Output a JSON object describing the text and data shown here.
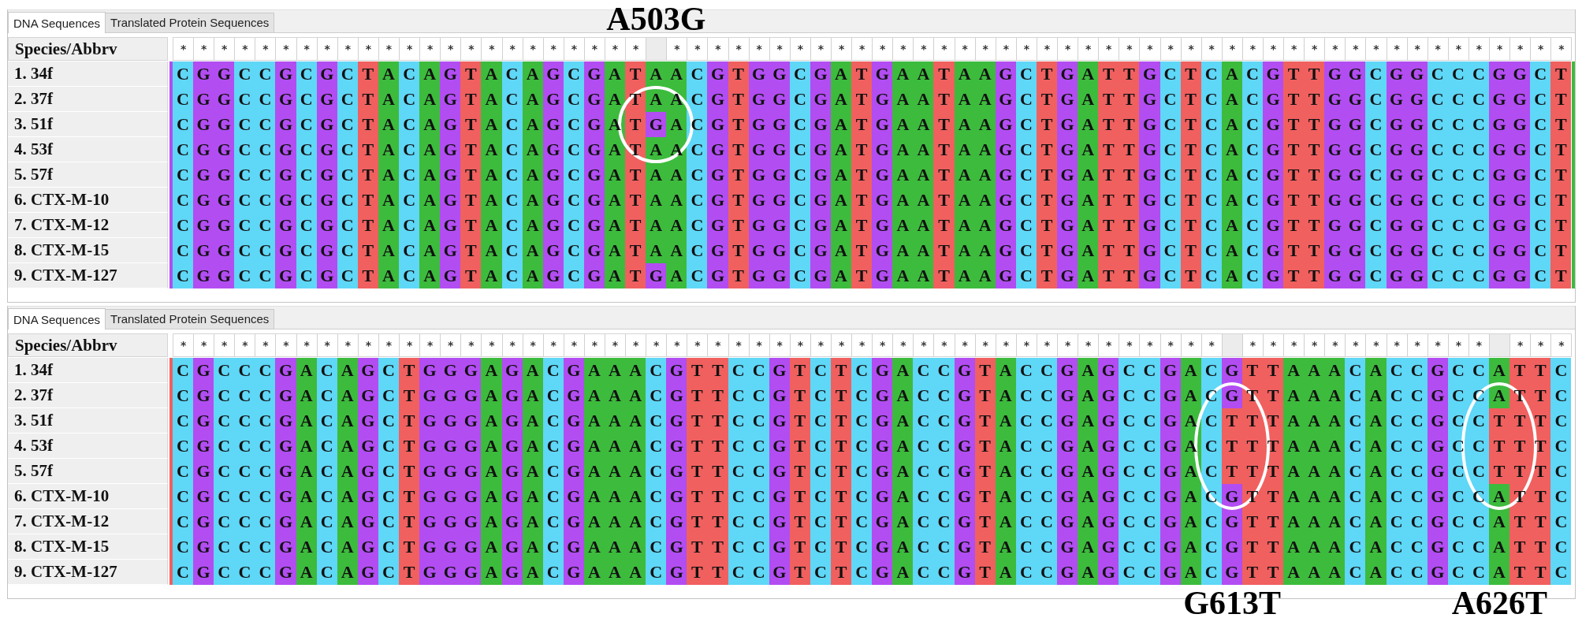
{
  "panels": [
    {
      "tabs": [
        {
          "label": "DNA Sequences",
          "selected": true
        },
        {
          "label": "Translated Protein Sequences",
          "selected": false
        }
      ],
      "mutations": [
        {
          "label": "A503G",
          "kind": "above"
        }
      ],
      "header": "Species/Abbrv",
      "consensus": [
        {
          "conserved": true,
          "mark": "*"
        },
        {
          "conserved": true,
          "mark": "*"
        },
        {
          "conserved": true,
          "mark": "*"
        },
        {
          "conserved": true,
          "mark": "*"
        },
        {
          "conserved": true,
          "mark": "*"
        },
        {
          "conserved": true,
          "mark": "*"
        },
        {
          "conserved": true,
          "mark": "*"
        },
        {
          "conserved": true,
          "mark": "*"
        },
        {
          "conserved": true,
          "mark": "*"
        },
        {
          "conserved": true,
          "mark": "*"
        },
        {
          "conserved": true,
          "mark": "*"
        },
        {
          "conserved": true,
          "mark": "*"
        },
        {
          "conserved": true,
          "mark": "*"
        },
        {
          "conserved": true,
          "mark": "*"
        },
        {
          "conserved": true,
          "mark": "*"
        },
        {
          "conserved": true,
          "mark": "*"
        },
        {
          "conserved": true,
          "mark": "*"
        },
        {
          "conserved": true,
          "mark": "*"
        },
        {
          "conserved": true,
          "mark": "*"
        },
        {
          "conserved": true,
          "mark": "*"
        },
        {
          "conserved": true,
          "mark": "*"
        },
        {
          "conserved": true,
          "mark": "*"
        },
        {
          "conserved": true,
          "mark": "*"
        },
        {
          "conserved": false
        },
        {
          "conserved": true,
          "mark": "*"
        },
        {
          "conserved": true,
          "mark": "*"
        },
        {
          "conserved": true,
          "mark": "*"
        },
        {
          "conserved": true,
          "mark": "*"
        },
        {
          "conserved": true,
          "mark": "*"
        },
        {
          "conserved": true,
          "mark": "*"
        },
        {
          "conserved": true,
          "mark": "*"
        },
        {
          "conserved": true,
          "mark": "*"
        },
        {
          "conserved": true,
          "mark": "*"
        },
        {
          "conserved": true,
          "mark": "*"
        },
        {
          "conserved": true,
          "mark": "*"
        },
        {
          "conserved": true,
          "mark": "*"
        },
        {
          "conserved": true,
          "mark": "*"
        },
        {
          "conserved": true,
          "mark": "*"
        },
        {
          "conserved": true,
          "mark": "*"
        },
        {
          "conserved": true,
          "mark": "*"
        },
        {
          "conserved": true,
          "mark": "*"
        },
        {
          "conserved": true,
          "mark": "*"
        },
        {
          "conserved": true,
          "mark": "*"
        },
        {
          "conserved": true,
          "mark": "*"
        },
        {
          "conserved": true,
          "mark": "*"
        },
        {
          "conserved": true,
          "mark": "*"
        },
        {
          "conserved": true,
          "mark": "*"
        },
        {
          "conserved": true,
          "mark": "*"
        },
        {
          "conserved": true,
          "mark": "*"
        },
        {
          "conserved": true,
          "mark": "*"
        },
        {
          "conserved": true,
          "mark": "*"
        },
        {
          "conserved": true,
          "mark": "*"
        },
        {
          "conserved": true,
          "mark": "*"
        },
        {
          "conserved": true,
          "mark": "*"
        },
        {
          "conserved": true,
          "mark": "*"
        },
        {
          "conserved": true,
          "mark": "*"
        },
        {
          "conserved": true,
          "mark": "*"
        },
        {
          "conserved": true,
          "mark": "*"
        },
        {
          "conserved": true,
          "mark": "*"
        },
        {
          "conserved": true,
          "mark": "*"
        },
        {
          "conserved": true,
          "mark": "*"
        },
        {
          "conserved": true,
          "mark": "*"
        },
        {
          "conserved": true,
          "mark": "*"
        },
        {
          "conserved": true,
          "mark": "*"
        },
        {
          "conserved": true,
          "mark": "*"
        },
        {
          "conserved": true,
          "mark": "*"
        },
        {
          "conserved": true,
          "mark": "*"
        },
        {
          "conserved": true,
          "mark": "*"
        }
      ],
      "edges": [
        {
          "kind": "left",
          "color": "#b24df2"
        },
        {
          "kind": "right",
          "color": "#3dbb3d"
        }
      ],
      "rows": [
        {
          "name": "1. 34f",
          "circled": false,
          "bases": "C G G C C G C G C T A C A G T A C A G C G A T A A C G T G G C G A T G A A T A A G C T G A T T G C T C A C G T T G G C G G C C C G G C T"
        },
        {
          "name": "2. 37f",
          "circled": true,
          "bases": "C G G C C G C G C T A C A G T A C A G C G A T A A C G T G G C G A T G A A T A A G C T G A T T G C T C A C G T T G G C G G C C C G G C T"
        },
        {
          "name": "3. 51f",
          "circled": true,
          "bases": "C G G C C G C G C T A C A G T A C A G C G A T G A C G T G G C G A T G A A T A A G C T G A T T G C T C A C G T T G G C G G C C C G G C T"
        },
        {
          "name": "4. 53f",
          "circled": true,
          "bases": "C G G C C G C G C T A C A G T A C A G C G A T A A C G T G G C G A T G A A T A A G C T G A T T G C T C A C G T T G G C G G C C C G G C T"
        },
        {
          "name": "5. 57f",
          "circled": false,
          "bases": "C G G C C G C G C T A C A G T A C A G C G A T A A C G T G G C G A T G A A T A A G C T G A T T G C T C A C G T T G G C G G C C C G G C T"
        },
        {
          "name": "6. CTX-M-10",
          "circled": false,
          "bases": "C G G C C G C G C T A C A G T A C A G C G A T A A C G T G G C G A T G A A T A A G C T G A T T G C T C A C G T T G G C G G C C C G G C T"
        },
        {
          "name": "7. CTX-M-12",
          "circled": false,
          "bases": "C G G C C G C G C T A C A G T A C A G C G A T A A C G T G G C G A T G A A T A A G C T G A T T G C T C A C G T T G G C G G C C C G G C T"
        },
        {
          "name": "8. CTX-M-15",
          "circled": false,
          "bases": "C G G C C G C G C T A C A G T A C A G C G A T A A C G T G G C G A T G A A T A A G C T G A T T G C T C A C G T T G G C G G C C C G G C T"
        },
        {
          "name": "9. CTX-M-127",
          "circled": false,
          "bases": "C G G C C G C G C T A C A G T A C A G C G A T G A C G T G G C G A T G A A T A A G C T G A T T G C T C A C G T T G G C G G C C C G G C T"
        }
      ]
    },
    {
      "tabs": [
        {
          "label": "DNA Sequences",
          "selected": true
        },
        {
          "label": "Translated Protein Sequences",
          "selected": false
        }
      ],
      "header": "Species/Abbrv",
      "consensus": [
        {
          "conserved": true,
          "mark": "*"
        },
        {
          "conserved": true,
          "mark": "*"
        },
        {
          "conserved": true,
          "mark": "*"
        },
        {
          "conserved": true,
          "mark": "*"
        },
        {
          "conserved": true,
          "mark": "*"
        },
        {
          "conserved": true,
          "mark": "*"
        },
        {
          "conserved": true,
          "mark": "*"
        },
        {
          "conserved": true,
          "mark": "*"
        },
        {
          "conserved": true,
          "mark": "*"
        },
        {
          "conserved": true,
          "mark": "*"
        },
        {
          "conserved": true,
          "mark": "*"
        },
        {
          "conserved": true,
          "mark": "*"
        },
        {
          "conserved": true,
          "mark": "*"
        },
        {
          "conserved": true,
          "mark": "*"
        },
        {
          "conserved": true,
          "mark": "*"
        },
        {
          "conserved": true,
          "mark": "*"
        },
        {
          "conserved": true,
          "mark": "*"
        },
        {
          "conserved": true,
          "mark": "*"
        },
        {
          "conserved": true,
          "mark": "*"
        },
        {
          "conserved": true,
          "mark": "*"
        },
        {
          "conserved": true,
          "mark": "*"
        },
        {
          "conserved": true,
          "mark": "*"
        },
        {
          "conserved": true,
          "mark": "*"
        },
        {
          "conserved": true,
          "mark": "*"
        },
        {
          "conserved": true,
          "mark": "*"
        },
        {
          "conserved": true,
          "mark": "*"
        },
        {
          "conserved": true,
          "mark": "*"
        },
        {
          "conserved": true,
          "mark": "*"
        },
        {
          "conserved": true,
          "mark": "*"
        },
        {
          "conserved": true,
          "mark": "*"
        },
        {
          "conserved": true,
          "mark": "*"
        },
        {
          "conserved": true,
          "mark": "*"
        },
        {
          "conserved": true,
          "mark": "*"
        },
        {
          "conserved": true,
          "mark": "*"
        },
        {
          "conserved": true,
          "mark": "*"
        },
        {
          "conserved": true,
          "mark": "*"
        },
        {
          "conserved": true,
          "mark": "*"
        },
        {
          "conserved": true,
          "mark": "*"
        },
        {
          "conserved": true,
          "mark": "*"
        },
        {
          "conserved": true,
          "mark": "*"
        },
        {
          "conserved": true,
          "mark": "*"
        },
        {
          "conserved": true,
          "mark": "*"
        },
        {
          "conserved": true,
          "mark": "*"
        },
        {
          "conserved": true,
          "mark": "*"
        },
        {
          "conserved": true,
          "mark": "*"
        },
        {
          "conserved": true,
          "mark": "*"
        },
        {
          "conserved": true,
          "mark": "*"
        },
        {
          "conserved": true,
          "mark": "*"
        },
        {
          "conserved": true,
          "mark": "*"
        },
        {
          "conserved": true,
          "mark": "*"
        },
        {
          "conserved": true,
          "mark": "*"
        },
        {
          "conserved": false
        },
        {
          "conserved": true,
          "mark": "*"
        },
        {
          "conserved": true,
          "mark": "*"
        },
        {
          "conserved": true,
          "mark": "*"
        },
        {
          "conserved": true,
          "mark": "*"
        },
        {
          "conserved": true,
          "mark": "*"
        },
        {
          "conserved": true,
          "mark": "*"
        },
        {
          "conserved": true,
          "mark": "*"
        },
        {
          "conserved": true,
          "mark": "*"
        },
        {
          "conserved": true,
          "mark": "*"
        },
        {
          "conserved": true,
          "mark": "*"
        },
        {
          "conserved": true,
          "mark": "*"
        },
        {
          "conserved": true,
          "mark": "*"
        },
        {
          "conserved": false
        },
        {
          "conserved": true,
          "mark": "*"
        },
        {
          "conserved": true,
          "mark": "*"
        },
        {
          "conserved": true,
          "mark": "*"
        }
      ],
      "edges": [
        {
          "kind": "left",
          "color": "#f0605f"
        }
      ],
      "rows": [
        {
          "name": "1. 34f",
          "circled": false,
          "bases": "C G C C C G A C A G C T G G G A G A C G A A A C G T T C C G T C T C G A C C G T A C C G A G C C G A C G T T A A A C A C C G C C A T T C"
        },
        {
          "name": "2. 37f",
          "circled": true,
          "bases": "C G C C C G A C A G C T G G G A G A C G A A A C G T T C C G T C T C G A C C G T A C C G A G C C G A C G T T A A A C A C C G C C A T T C"
        },
        {
          "name": "3. 51f",
          "circled": true,
          "bases": "C G C C C G A C A G C T G G G A G A C G A A A C G T T C C G T C T C G A C C G T A C C G A G C C G A C T T T A A A C A C C G C C T T T C"
        },
        {
          "name": "4. 53f",
          "circled": true,
          "bases": "C G C C C G A C A G C T G G G A G A C G A A A C G T T C C G T C T C G A C C G T A C C G A G C C G A C T T T A A A C A C C G C C T T T C"
        },
        {
          "name": "5. 57f",
          "circled": true,
          "bases": "C G C C C G A C A G C T G G G A G A C G A A A C G T T C C G T C T C G A C C G T A C C G A G C C G A C T T T A A A C A C C G C C T T T C"
        },
        {
          "name": "6. CTX-M-10",
          "circled": true,
          "bases": "C G C C C G A C A G C T G G G A G A C G A A A C G T T C C G T C T C G A C C G T A C C G A G C C G A C G T T A A A C A C C G C C A T T C"
        },
        {
          "name": "7. CTX-M-12",
          "circled": false,
          "bases": "C G C C C G A C A G C T G G G A G A C G A A A C G T T C C G T C T C G A C C G T A C C G A G C C G A C G T T A A A C A C C G C C A T T C"
        },
        {
          "name": "8. CTX-M-15",
          "circled": false,
          "bases": "C G C C C G A C A G C T G G G A G A C G A A A C G T T C C G T C T C G A C C G T A C C G A G C C G A C G T T A A A C A C C G C C A T T C"
        },
        {
          "name": "9. CTX-M-127",
          "circled": false,
          "bases": "C G C C C G A C A G C T G G G A G A C G A A A C G T T C C G T C T C G A C C G T A C C G A G C C G A C G T T A A A C A C C G C C A T T C"
        }
      ],
      "mutations": [
        {
          "label": "G613T",
          "kind": "below"
        },
        {
          "label": "A626T",
          "kind": "below"
        }
      ]
    }
  ]
}
